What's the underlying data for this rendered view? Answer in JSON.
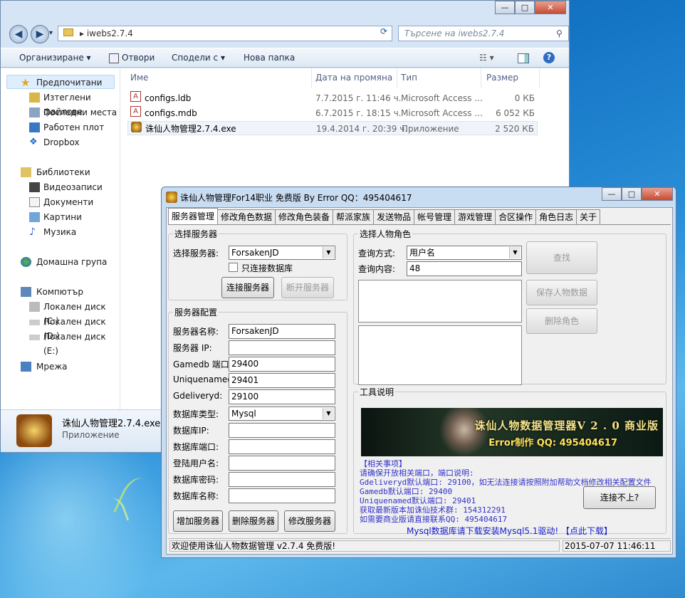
{
  "explorer": {
    "caption": {
      "minimize": "—",
      "maximize": "□",
      "close": "✕"
    },
    "nav": {
      "back": "◀",
      "forward": "▶",
      "dropdown": "▾"
    },
    "address": "▸ iwebs2.7.4",
    "search_placeholder": "Търсене на iwebs2.7.4",
    "toolbar": {
      "organize": "Организиране ▾",
      "open": "Отвори",
      "share": "Сподели с ▾",
      "new_folder": "Нова папка"
    },
    "sidebar": {
      "favorites": "Предпочитани",
      "downloads": "Изтеглени файлове",
      "recent": "Последни места",
      "desktop": "Работен плот",
      "dropbox": "Dropbox",
      "libraries": "Библиотеки",
      "videos": "Видеозаписи",
      "documents": "Документи",
      "pictures": "Картини",
      "music": "Музика",
      "homegroup": "Домашна група",
      "computer": "Компютър",
      "disk_c": "Локален диск (C:)",
      "disk_d": "Локален диск (D:)",
      "disk_e": "Локален диск (E:)",
      "network": "Мрежа"
    },
    "columns": {
      "name": "Име",
      "date": "Дата на промяна",
      "type": "Тип",
      "size": "Размер"
    },
    "files": [
      {
        "name": "configs.ldb",
        "date": "7.7.2015 г. 11:46 ч.",
        "type": "Microsoft Access ...",
        "size": "0 КБ"
      },
      {
        "name": "configs.mdb",
        "date": "6.7.2015 г. 18:15 ч.",
        "type": "Microsoft Access ...",
        "size": "6 052 КБ"
      },
      {
        "name": "诛仙人物管理2.7.4.exe",
        "date": "19.4.2014 г. 20:39 ч.",
        "type": "Приложение",
        "size": "2 520 КБ"
      }
    ],
    "details": {
      "name": "诛仙人物管理2.7.4.exe",
      "type": "Приложение"
    }
  },
  "app": {
    "title": "诛仙人物管理For14职业 免费版 By Error QQ：495404617",
    "tabs": [
      "服务器管理",
      "修改角色数据",
      "修改角色装备",
      "帮派家族",
      "发送物品",
      "帐号管理",
      "游戏管理",
      "合区操作",
      "角色日志",
      "关于"
    ],
    "select_server": {
      "legend": "选择服务器",
      "label": "选择服务器:",
      "value": "ForsakenJD",
      "checkbox": "只连接数据库",
      "connect": "连接服务器",
      "disconnect": "断开服务器"
    },
    "server_config": {
      "legend": "服务器配置",
      "fields": [
        {
          "label": "服务器名称:",
          "value": "ForsakenJD"
        },
        {
          "label": "服务器 IP:",
          "value": ""
        },
        {
          "label": "Gamedb 端口:",
          "value": "29400"
        },
        {
          "label": "Uniquenamed:",
          "value": "29401"
        },
        {
          "label": "Gdeliveryd:",
          "value": "29100"
        },
        {
          "label": "数据库类型:",
          "value": "Mysql"
        },
        {
          "label": "数据库IP:",
          "value": ""
        },
        {
          "label": "数据库端口:",
          "value": ""
        },
        {
          "label": "登陆用户名:",
          "value": ""
        },
        {
          "label": "数据库密码:",
          "value": ""
        },
        {
          "label": "数据库名称:",
          "value": ""
        }
      ],
      "add": "增加服务器",
      "delete": "删除服务器",
      "modify": "修改服务器"
    },
    "select_role": {
      "legend": "选择人物角色",
      "method_label": "查询方式:",
      "method_value": "用户名",
      "content_label": "查询内容:",
      "content_value": "48",
      "search": "查找",
      "save": "保存人物数据",
      "delete": "删除角色"
    },
    "tool_info": {
      "legend": "工具说明",
      "banner_title": "诛仙人物数据管理器V 2 . 0 商业版",
      "banner_sub": "Error制作 QQ: 495404617",
      "notes": [
        "【相关事项】",
        "请确保开放相关端口，端口说明:",
        "Gdeliveryd默认端口: 29100，如无法连接请按照附加帮助文档修改相关配置文件",
        "Gamedb默认端口: 29400",
        "Uniquenamed默认端口: 29401",
        "获取最新版本加诛仙技术群: 154312291",
        "如需要商业版请直接联系QQ: 495404617"
      ],
      "cannot_connect": "连接不上?",
      "mysql_link": "Mysql数据库请下载安装Mysql5.1驱动! 【点此下载】"
    },
    "status": {
      "left": "欢迎使用诛仙人物数据管理 v2.7.4 免费版!",
      "right": "2015-07-07 11:46:11"
    }
  }
}
